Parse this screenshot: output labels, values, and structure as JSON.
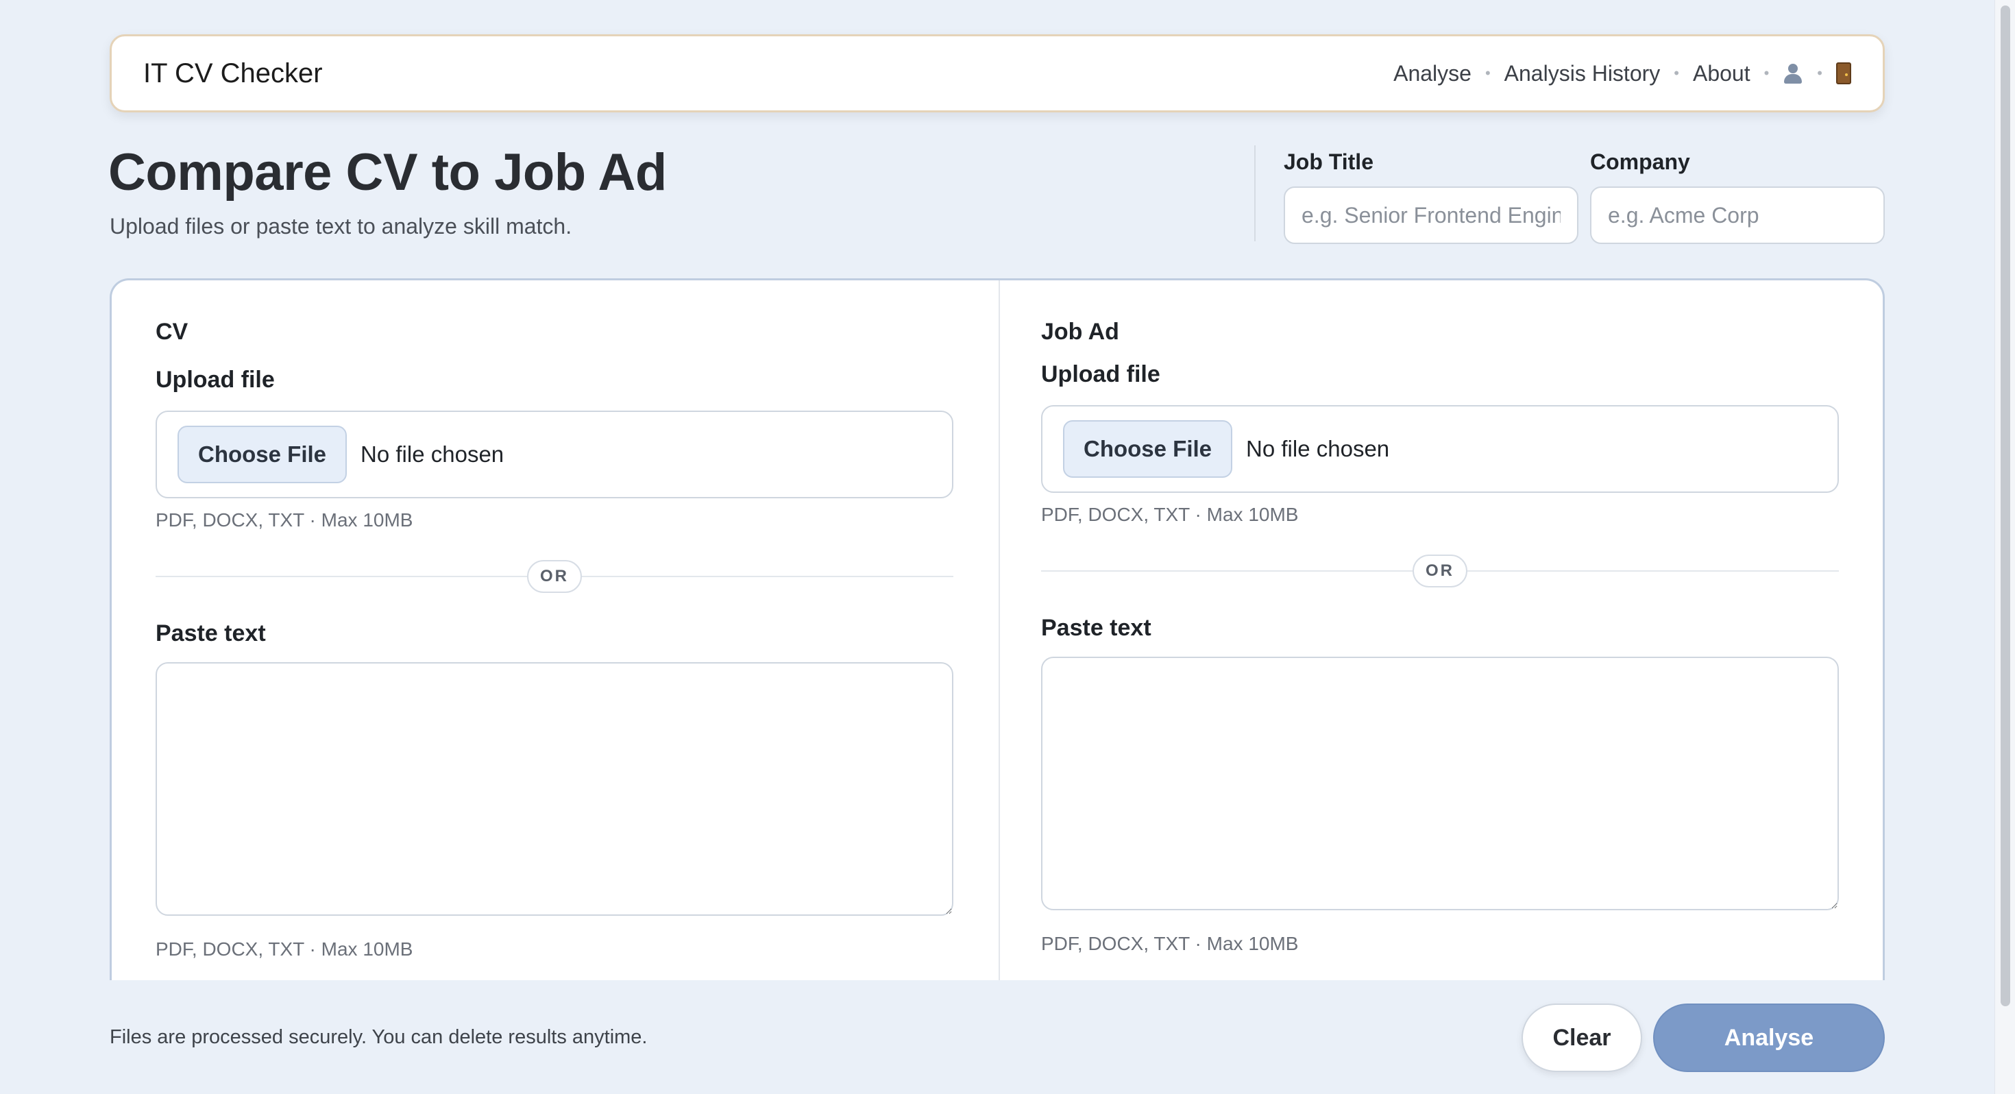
{
  "app": {
    "brand": "IT CV Checker"
  },
  "nav": {
    "items": [
      "Analyse",
      "Analysis History",
      "About"
    ],
    "separator": "•",
    "icons": [
      "user-icon",
      "door-icon"
    ]
  },
  "page": {
    "title": "Compare CV to Job Ad",
    "subtitle": "Upload files or paste text to analyze skill match."
  },
  "meta": {
    "job_title_label": "Job Title",
    "job_title_placeholder": "e.g. Senior Frontend Engineer",
    "job_title_value": "",
    "company_label": "Company",
    "company_placeholder": "e.g. Acme Corp",
    "company_value": ""
  },
  "cv": {
    "section_title": "CV",
    "upload_label": "Upload file",
    "choose_button": "Choose File",
    "file_status": "No file chosen",
    "upload_hint": "PDF, DOCX, TXT · Max 10MB",
    "or": "OR",
    "paste_label": "Paste text",
    "paste_value": "",
    "paste_hint": "PDF, DOCX, TXT · Max 10MB"
  },
  "job_ad": {
    "section_title": "Job Ad",
    "upload_label": "Upload file",
    "choose_button": "Choose File",
    "file_status": "No file chosen",
    "upload_hint": "PDF, DOCX, TXT · Max 10MB",
    "or": "OR",
    "paste_label": "Paste text",
    "paste_value": "",
    "paste_hint": "PDF, DOCX, TXT · Max 10MB"
  },
  "footer": {
    "note": "Files are processed securely. You can delete results anytime.",
    "clear_label": "Clear",
    "analyse_label": "Analyse"
  },
  "colors": {
    "background": "#eaf0f8",
    "primary_button": "#7c9ac8",
    "navbar_border": "#e5d3b8",
    "card_border": "#bfcde0"
  }
}
